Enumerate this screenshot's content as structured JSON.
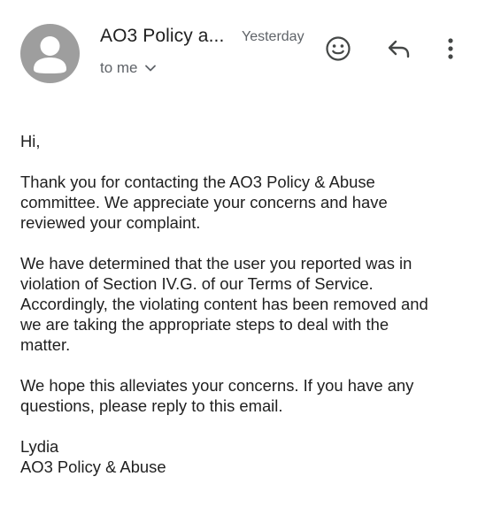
{
  "header": {
    "sender_name": "AO3 Policy a...",
    "date": "Yesterday",
    "recipient": "to me"
  },
  "icons": {
    "avatar": "person-avatar-icon",
    "recipient_toggle": "chevron-down-icon",
    "emoji": "smiley-emoji-icon",
    "reply": "reply-arrow-icon",
    "more": "more-vertical-icon"
  },
  "colors": {
    "avatar_bg": "#9e9e9e",
    "text_primary": "#1f1f1f",
    "text_secondary": "#5f6368",
    "icon": "#444746"
  },
  "message": {
    "greeting": "Hi,",
    "paragraph_1": "Thank you for contacting the AO3 Policy & Abuse\ncommittee. We appreciate your concerns and have\nreviewed your complaint.",
    "paragraph_2": "We have determined that the user you reported was in\nviolation of Section IV.G. of our Terms of Service.\nAccordingly, the violating content has been removed and\nwe are taking the appropriate steps to deal with the\nmatter.",
    "paragraph_3": "We hope this alleviates your concerns. If you have any\nquestions, please reply to this email.",
    "signature": "Lydia\nAO3 Policy & Abuse"
  }
}
